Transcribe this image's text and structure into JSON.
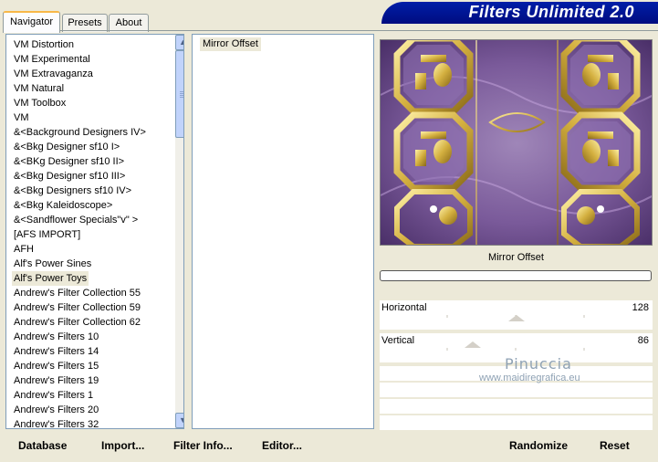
{
  "tabs": [
    "Navigator",
    "Presets",
    "About"
  ],
  "brand": "Filters Unlimited 2.0",
  "categories": [
    "VM Distortion",
    "VM Experimental",
    "VM Extravaganza",
    "VM Natural",
    "VM Toolbox",
    "VM",
    "&<Background Designers IV>",
    "&<Bkg Designer sf10 I>",
    "&<BKg Designer sf10 II>",
    "&<Bkg Designer sf10 III>",
    "&<Bkg Designers sf10 IV>",
    "&<Bkg Kaleidoscope>",
    "&<Sandflower Specials\"v\" >",
    "[AFS IMPORT]",
    "AFH",
    "Alf's Power Sines",
    "Alf's Power Toys",
    "Andrew's Filter Collection 55",
    "Andrew's Filter Collection 59",
    "Andrew's Filter Collection 62",
    "Andrew's Filters 10",
    "Andrew's Filters 14",
    "Andrew's Filters 15",
    "Andrew's Filters 19",
    "Andrew's Filters 1",
    "Andrew's Filters 20",
    "Andrew's Filters 32"
  ],
  "selected_category": "Alf's Power Toys",
  "filter": "Mirror Offset",
  "preview_title": "Mirror Offset",
  "params": [
    {
      "label": "Horizontal",
      "value": "128",
      "fraction": 0.5
    },
    {
      "label": "Vertical",
      "value": "86",
      "fraction": 0.34
    }
  ],
  "watermark": {
    "name": "Pinuccia",
    "site": "www.maidiregrafica.eu"
  },
  "buttons": {
    "database": "Database",
    "import": "Import...",
    "filter_info": "Filter Info...",
    "editor": "Editor...",
    "randomize": "Randomize",
    "reset": "Reset"
  },
  "colors": {
    "brand_bg": "#000c80",
    "tab_accent": "#f8b848",
    "preview_purple": "#7a5a9a",
    "gold": "#d4b040"
  }
}
